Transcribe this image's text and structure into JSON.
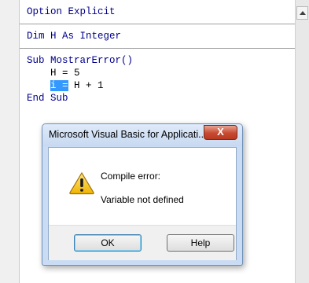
{
  "editor": {
    "lines": {
      "l1": "Option Explicit",
      "l2": "Dim H As Integer",
      "l3": "Sub MostrarError()",
      "l4": "    H = 5",
      "l5_indent": "    ",
      "l5_selected": "i =",
      "l5_rest": " H + 1",
      "l6": "End Sub"
    }
  },
  "dialog": {
    "title": "Microsoft Visual Basic for Applicati...",
    "close_glyph": "X",
    "icon": "warning-icon",
    "message_title": "Compile error:",
    "message_detail": "Variable not defined",
    "ok_label": "OK",
    "help_label": "Help"
  },
  "colors": {
    "keyword": "#00008b",
    "selection": "#3399ff",
    "close_button": "#c74a32"
  }
}
